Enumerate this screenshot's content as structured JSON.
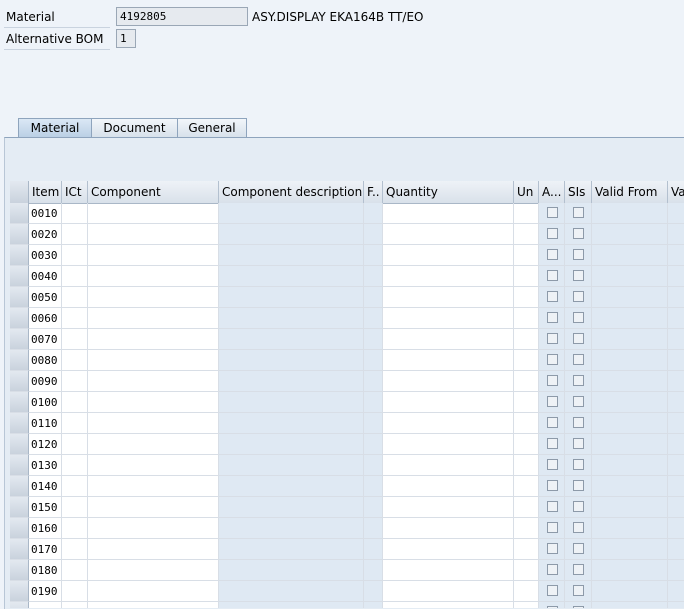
{
  "header": {
    "material_label": "Material",
    "material_value": "4192805",
    "material_description": "ASY.DISPLAY EKA164B TT/EO",
    "alt_bom_label": "Alternative BOM",
    "alt_bom_value": "1"
  },
  "tabs": [
    {
      "label": "Material",
      "active": true
    },
    {
      "label": "Document",
      "active": false
    },
    {
      "label": "General",
      "active": false
    }
  ],
  "table": {
    "columns": [
      "Item",
      "ICt",
      "Component",
      "Component description",
      "F..",
      "Quantity",
      "Un",
      "A...",
      "SIs",
      "Valid From",
      "Va"
    ],
    "items": [
      "0010",
      "0020",
      "0030",
      "0040",
      "0050",
      "0060",
      "0070",
      "0080",
      "0090",
      "0100",
      "0110",
      "0120",
      "0130",
      "0140",
      "0150",
      "0160",
      "0170",
      "0180",
      "0190",
      ""
    ]
  }
}
